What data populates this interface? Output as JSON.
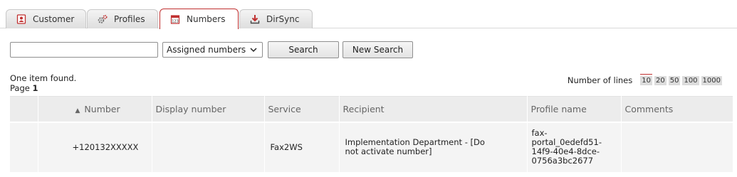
{
  "tabs": [
    {
      "label": "Customer",
      "icon": "customer-icon",
      "active": false
    },
    {
      "label": "Profiles",
      "icon": "gears-icon",
      "active": false
    },
    {
      "label": "Numbers",
      "icon": "calendar-icon",
      "active": true
    },
    {
      "label": "DirSync",
      "icon": "download-icon",
      "active": false
    }
  ],
  "search": {
    "value": "",
    "filter_selected": "Assigned numbers",
    "search_label": "Search",
    "new_search_label": "New Search"
  },
  "results": {
    "found_text": "One item found.",
    "page_label": "Page",
    "page_number": "1"
  },
  "pagination": {
    "label": "Number of lines",
    "options": [
      "10",
      "20",
      "50",
      "100",
      "1000"
    ],
    "selected": "10"
  },
  "table": {
    "columns": [
      "",
      "Number",
      "Display number",
      "Service",
      "Recipient",
      "Profile name",
      "Comments"
    ],
    "sorted_column": "Number",
    "rows": [
      {
        "number": "+120132XXXXX",
        "display_number": "",
        "service": "Fax2WS",
        "recipient": "Implementation Department - [Do not activate number]",
        "profile_name": "fax-portal_0edefd51-14f9-40e4-8dce-0756a3bc2677",
        "comments": ""
      }
    ]
  },
  "colors": {
    "accent": "#c03030",
    "header_bg": "#ececec",
    "row_bg": "#f4f4f4"
  }
}
